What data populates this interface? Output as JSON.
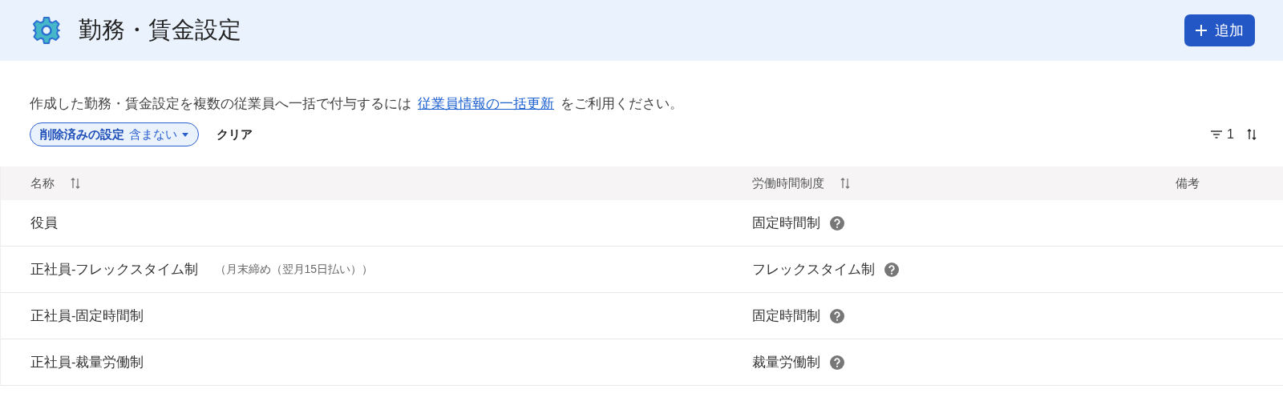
{
  "header": {
    "title": "勤務・賃金設定",
    "add_button": "追加"
  },
  "description": {
    "text": "作成した勤務・賃金設定を複数の従業員へ一括で付与するには",
    "link": "従業員情報の一括更新",
    "suffix": "をご利用ください。"
  },
  "filter_chip": {
    "label": "削除済みの設定",
    "value": "含まない"
  },
  "clear_button": "クリア",
  "filter_count": "1",
  "table": {
    "columns": [
      {
        "label": "名称",
        "sortable": true
      },
      {
        "label": "労働時間制度",
        "sortable": true
      },
      {
        "label": "備考",
        "sortable": false
      }
    ],
    "rows": [
      {
        "name": "役員",
        "note": "",
        "system": "固定時間制"
      },
      {
        "name": "正社員-フレックスタイム制",
        "note": "（月末締め（翌月15日払い））",
        "system": "フレックスタイム制"
      },
      {
        "name": "正社員-固定時間制",
        "note": "",
        "system": "固定時間制"
      },
      {
        "name": "正社員-裁量労働制",
        "note": "",
        "system": "裁量労働制"
      }
    ]
  }
}
